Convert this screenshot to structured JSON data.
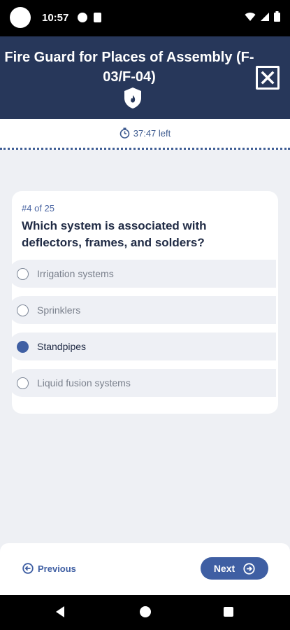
{
  "status_bar": {
    "time": "10:57"
  },
  "header": {
    "title": "Fire Guard for Places of Assembly (F-03/F-04)"
  },
  "timer": {
    "text": "37:47 left"
  },
  "question": {
    "number": "#4 of 25",
    "text": "Which system is associated with deflectors, frames, and solders?",
    "options": [
      {
        "label": "Irrigation systems",
        "selected": false
      },
      {
        "label": "Sprinklers",
        "selected": false
      },
      {
        "label": "Standpipes",
        "selected": true
      },
      {
        "label": "Liquid fusion systems",
        "selected": false
      }
    ]
  },
  "nav": {
    "previous_label": "Previous",
    "next_label": "Next"
  },
  "colors": {
    "header_bg": "#27375a",
    "accent": "#3f5fa3",
    "page_bg": "#eef0f4"
  }
}
